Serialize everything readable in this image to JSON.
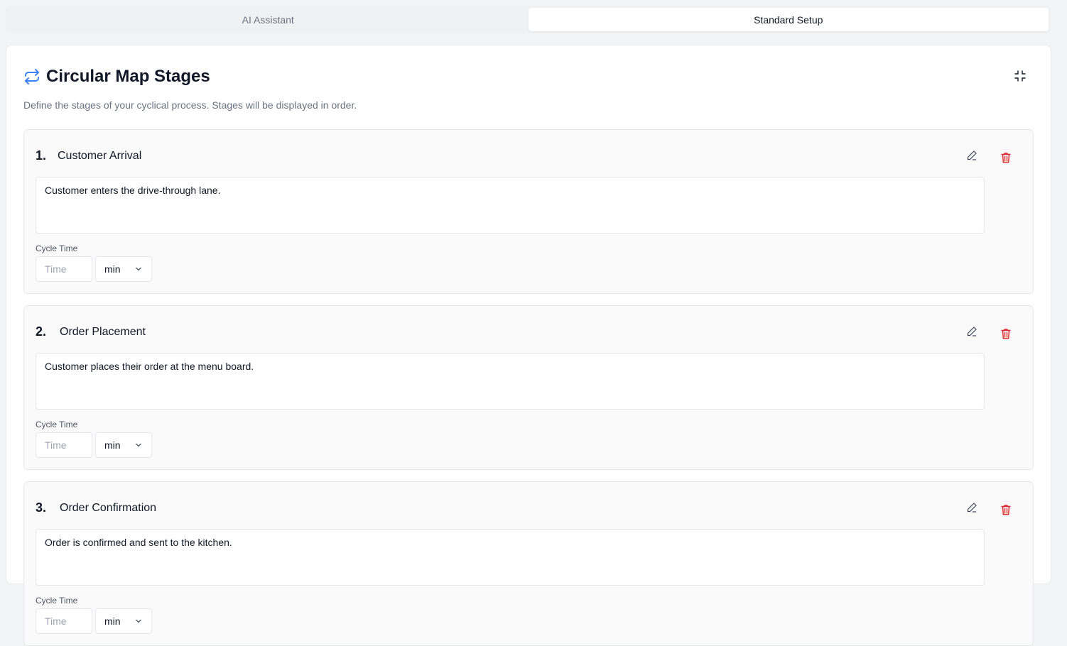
{
  "tabs": [
    {
      "label": "AI Assistant",
      "active": false
    },
    {
      "label": "Standard Setup",
      "active": true
    }
  ],
  "card": {
    "title": "Circular Map Stages",
    "description": "Define the stages of your cyclical process. Stages will be displayed in order."
  },
  "stages": [
    {
      "number": "1.",
      "name": "Customer Arrival",
      "description": "Customer enters the drive-through lane.",
      "cycle_time_label": "Cycle Time",
      "time_placeholder": "Time",
      "unit": "min"
    },
    {
      "number": "2.",
      "name": "Order Placement",
      "description": "Customer places their order at the menu board.",
      "cycle_time_label": "Cycle Time",
      "time_placeholder": "Time",
      "unit": "min"
    },
    {
      "number": "3.",
      "name": "Order Confirmation",
      "description": "Order is confirmed and sent to the kitchen.",
      "cycle_time_label": "Cycle Time",
      "time_placeholder": "Time",
      "unit": "min"
    }
  ],
  "icons": {
    "header": "cycle-arrows-icon",
    "collapse": "collapse-icon",
    "edit": "pencil-icon",
    "delete": "trash-icon",
    "select": "chevron-down-icon"
  },
  "colors": {
    "accent": "#3b82f6",
    "danger": "#dc2626"
  }
}
